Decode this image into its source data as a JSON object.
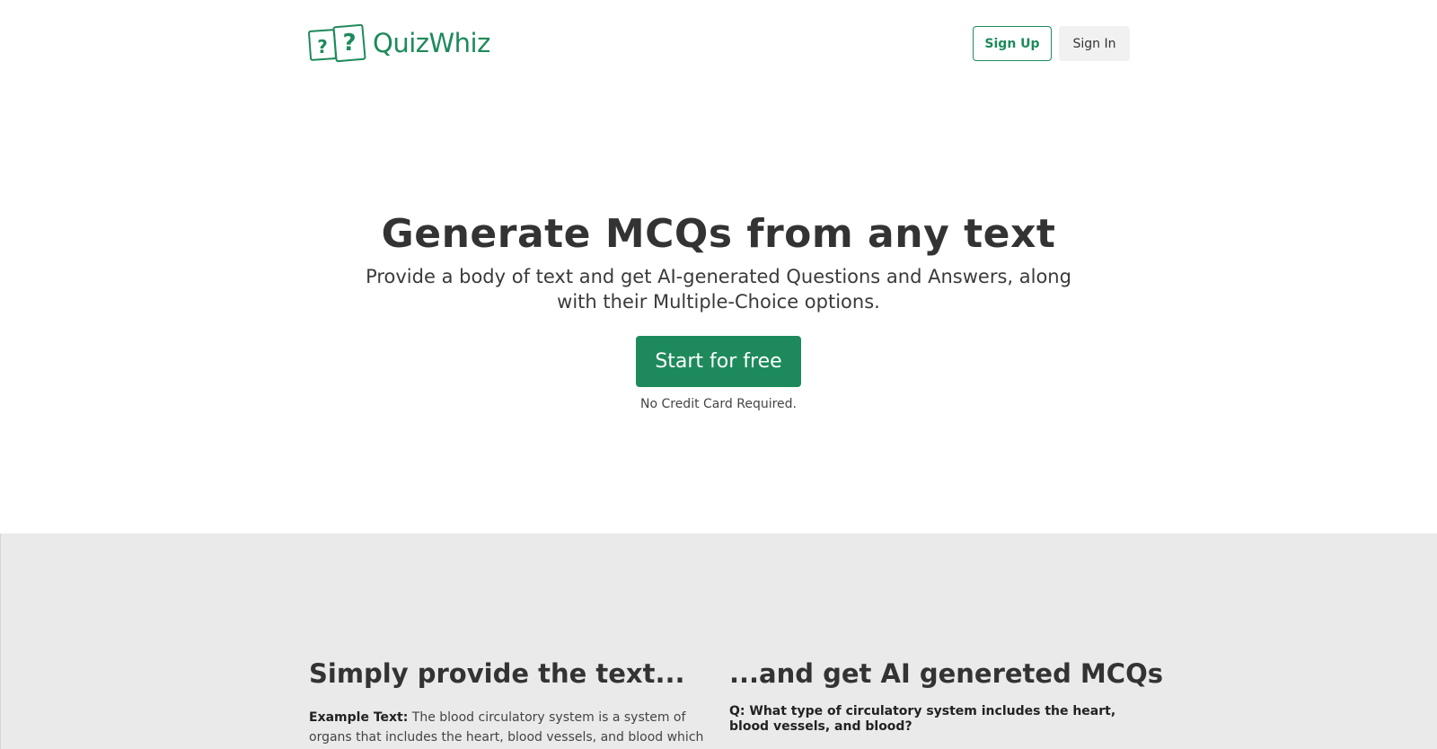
{
  "brand": {
    "name": "QuizWhiz",
    "icon": "question-cards-logo-icon",
    "color": "#1e8a5b"
  },
  "nav": {
    "signup_label": "Sign Up",
    "signin_label": "Sign In"
  },
  "hero": {
    "title": "Generate MCQs from any text",
    "subtitle": "Provide a body of text and get AI-generated Questions and Answers, along with their Multiple-Choice options.",
    "cta_label": "Start for free",
    "cta_note": "No Credit Card Required."
  },
  "demo": {
    "left_title": "Simply provide the text...",
    "example_label": "Example Text:",
    "example_text": "The blood circulatory system is a system of organs that includes the heart, blood vessels, and blood which is",
    "right_title": "...and get AI genereted MCQs",
    "question": "Q: What type of circulatory system includes the heart, blood vessels, and blood?"
  },
  "colors": {
    "accent": "#1e8a5b",
    "band_bg": "#eaeaea",
    "text": "#333333"
  }
}
